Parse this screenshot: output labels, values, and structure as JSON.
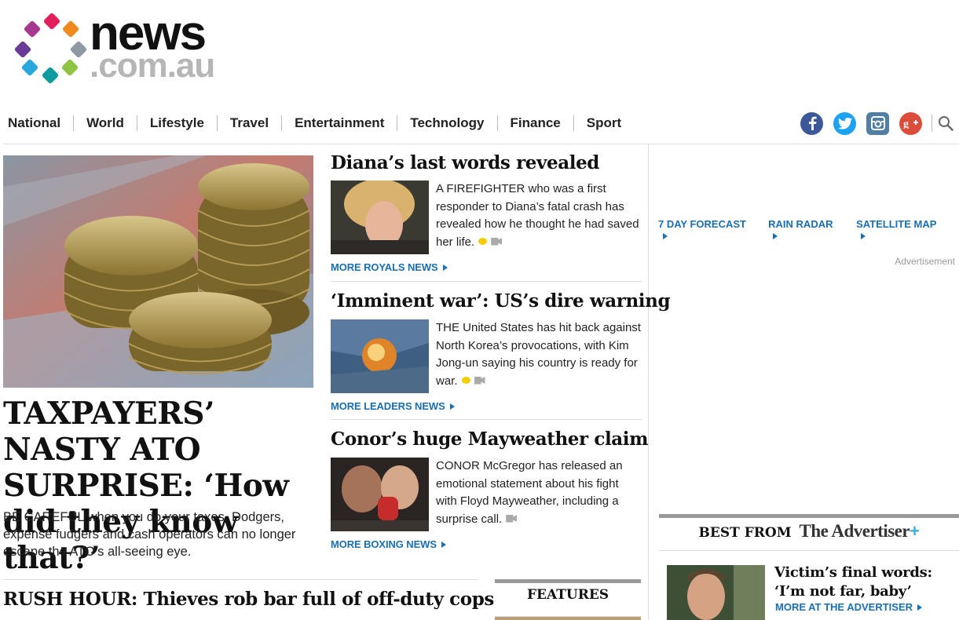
{
  "brand": {
    "word": "news",
    "sub": ".com.au"
  },
  "nav": [
    "National",
    "World",
    "Lifestyle",
    "Travel",
    "Entertainment",
    "Technology",
    "Finance",
    "Sport"
  ],
  "social": [
    {
      "name": "facebook-icon",
      "glyph": "f",
      "color": "#3b5998"
    },
    {
      "name": "twitter-icon",
      "glyph": "t",
      "color": "#1da1f2"
    },
    {
      "name": "instagram-icon",
      "glyph": "◎",
      "color": "#517fa4"
    },
    {
      "name": "google-plus-icon",
      "glyph": "g+",
      "color": "#dd4b39"
    }
  ],
  "hero": {
    "title": "TAXPAYERS’ NASTY ATO SURPRISE: ‘How did they know that?’",
    "desc": "BE CAREFUL when you do your taxes. Dodgers, expense fudgers and cash operators can no longer escape the ATO’s all-seeing eye."
  },
  "stories": [
    {
      "title": "Diana’s last words revealed",
      "desc": "A FIREFIGHTER who was a first responder to Diana’s fatal crash has revealed how he thought he had saved her life.",
      "comment": true,
      "more": "MORE ROYALS NEWS"
    },
    {
      "title": "‘Imminent war’: US’s dire warning",
      "desc": "THE United States has hit back against North Korea’s provocations, with Kim Jong-un saying his country is ready for war.",
      "comment": true,
      "more": "MORE LEADERS NEWS"
    },
    {
      "title": "Conor’s huge Mayweather claim",
      "desc": "CONOR McGregor has released an emotional statement about his fight with Floyd Mayweather, including a surprise call.",
      "comment": false,
      "more": "MORE BOXING NEWS"
    }
  ],
  "rush": "RUSH HOUR: Thieves rob bar full of off-duty cops",
  "features": "FEATURES",
  "weather_links": [
    "7 DAY FORECAST",
    "RAIN RADAR",
    "SATELLITE MAP"
  ],
  "advertisement": "Advertisement",
  "best": {
    "label": "BEST FROM",
    "brand": "The Advertiser",
    "plus": "+",
    "story_title": "Victim’s final words: ‘I’m not far, baby’",
    "more": "MORE AT THE ADVERTISER"
  }
}
